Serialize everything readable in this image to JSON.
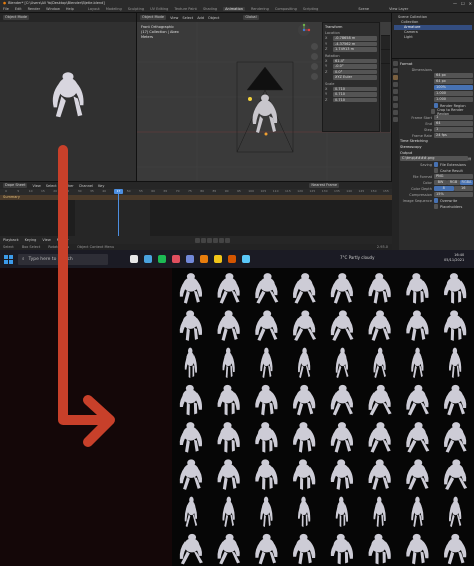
{
  "window": {
    "title": "Blender* [C:\\Users\\All Ya\\Desktop\\Blender\\Bjetle.blend]",
    "minimize": "—",
    "maximize": "☐",
    "close": "✕"
  },
  "menubar": {
    "items": [
      "File",
      "Edit",
      "Render",
      "Window",
      "Help"
    ],
    "workspaces": [
      "Layout",
      "Modeling",
      "Sculpting",
      "UV Editing",
      "Texture Paint",
      "Shading",
      "Animation",
      "Rendering",
      "Compositing",
      "Scripting"
    ],
    "active_workspace": "Animation",
    "scene_label": "Scene",
    "view_layer_label": "View Layer"
  },
  "left_view": {
    "mode": "Object Mode"
  },
  "viewport": {
    "mode": "Object Mode",
    "menu": [
      "View",
      "Select",
      "Add",
      "Object"
    ],
    "transform_orientation": "Global",
    "info": [
      "Front Orthographic",
      "(17) Collection | Abex",
      "Meters"
    ]
  },
  "npanel": {
    "title": "Transform",
    "location_label": "Location",
    "location": [
      {
        "axis": "X",
        "value": "-0.78658 m"
      },
      {
        "axis": "Y",
        "value": "-4.37562 m"
      },
      {
        "axis": "Z",
        "value": "1.74913 m"
      }
    ],
    "rotation_label": "Rotation",
    "rotation": [
      {
        "axis": "X",
        "value": "61.4°"
      },
      {
        "axis": "Y",
        "value": "-0.0°"
      },
      {
        "axis": "Z",
        "value": "0.0°"
      }
    ],
    "rotation_mode": "XYZ Euler",
    "scale_label": "Scale",
    "scale": [
      {
        "axis": "X",
        "value": "0.710"
      },
      {
        "axis": "Y",
        "value": "0.710"
      },
      {
        "axis": "Z",
        "value": "0.710"
      }
    ]
  },
  "outliner": {
    "rows": [
      "Scene Collection",
      "Collection",
      "Armature",
      "Camera",
      "Light"
    ],
    "selected_index": 2
  },
  "properties": {
    "format_section": "Format",
    "dimensions_label": "Dimensions",
    "resolution_x": "64 px",
    "resolution_y": "64 px",
    "percent": "100%",
    "aspect_x": "1.000",
    "aspect_y": "1.000",
    "render_region": "Render Region",
    "crop": "Crop to Render Region",
    "frame_start_label": "Frame Start",
    "frame_start": "1",
    "frame_end_label": "End",
    "frame_end": "64",
    "step_label": "Step",
    "step": "1",
    "frame_rate_label": "Frame Rate",
    "frame_rate": "24 fps",
    "time_stretching": "Time Stretching",
    "stereoscopy": "Stereoscopy",
    "output_section": "Output",
    "output_path": "C:\\tmp\\####.png",
    "saving_label": "Saving",
    "file_extensions": "File Extensions",
    "cache_result": "Cache Result",
    "file_format_label": "File Format",
    "file_format": "PNG",
    "color_label": "Color",
    "color_options": [
      "BW",
      "RGB",
      "RGBA"
    ],
    "color_depth_label": "Color Depth",
    "color_depth": [
      "8",
      "16"
    ],
    "compression_label": "Compression",
    "compression": "15%",
    "image_sequence_label": "Image Sequence",
    "overwrite": "Overwrite",
    "placeholders": "Placeholders"
  },
  "timeline": {
    "editor": "Dope Sheet",
    "menu": [
      "View",
      "Select",
      "Marker",
      "Channel",
      "Key"
    ],
    "nearest_frame": "Nearest Frame",
    "summary": "Summary",
    "ruler": [
      "0",
      "5",
      "10",
      "15",
      "20",
      "25",
      "30",
      "35",
      "40",
      "45",
      "50",
      "55",
      "60",
      "65",
      "70",
      "75",
      "80",
      "85",
      "90",
      "95",
      "100",
      "105",
      "110",
      "115",
      "120",
      "125",
      "130",
      "135",
      "140",
      "145",
      "150",
      "155"
    ],
    "current_frame": "17"
  },
  "playbar": {
    "items": [
      "Playback",
      "Keying",
      "View",
      "Marker"
    ]
  },
  "statusbar": {
    "items": [
      "Select",
      "Box Select",
      "Rotate View",
      "Object Context Menu"
    ],
    "version": "2.93.0"
  },
  "taskbar": {
    "search_placeholder": "Type here to search",
    "weather": "7°C  Partly cloudy",
    "time": "16:40",
    "date": "05/11/2021",
    "app_colors": [
      "#e8e8e8",
      "#4aa3df",
      "#1db954",
      "#e04f5f",
      "#7289da",
      "#e87d0d",
      "#f0c419",
      "#d45500",
      "#5ac8fa"
    ]
  },
  "sprite_sheet": {
    "columns": 8,
    "rows": 8,
    "frame_count": 64
  },
  "colors": {
    "arrow": "#c8402a",
    "selection": "#334d80",
    "accent_blue": "#4772b3",
    "playhead": "#4c8ee0",
    "sprite": "#cdccd6",
    "sheet_bg": "#060606",
    "page_bg": "#140708"
  }
}
